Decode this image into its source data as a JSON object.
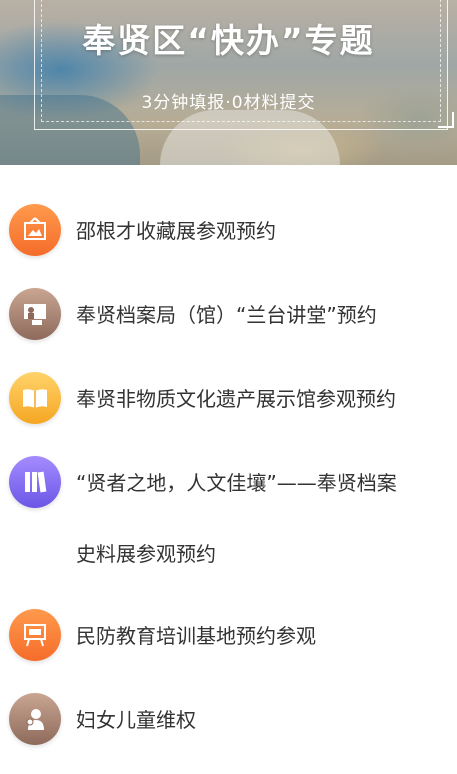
{
  "banner": {
    "title": "奉贤区“快办”专题",
    "subtitle": "3分钟填报·0材料提交"
  },
  "items": [
    {
      "label": "邵根才收藏展参观预约",
      "icon": "picture-frame-icon",
      "color": "#f56c2a"
    },
    {
      "label": "奉贤档案局（馆）“兰台讲堂”预约",
      "icon": "lecture-icon",
      "color": "#8e6a5c"
    },
    {
      "label": "奉贤非物质文化遗产展示馆参观预约",
      "icon": "book-icon",
      "color": "#f5a623"
    },
    {
      "label": "“贤者之地，人文佳壤”——奉贤档案",
      "label_line2": "史料展参观预约",
      "icon": "binders-icon",
      "color": "#6b56e6"
    },
    {
      "label": "民防教育培训基地预约参观",
      "icon": "presentation-board-icon",
      "color": "#f56c2a"
    },
    {
      "label": "妇女儿童维权",
      "icon": "mother-child-icon",
      "color": "#8e6a5c"
    }
  ]
}
